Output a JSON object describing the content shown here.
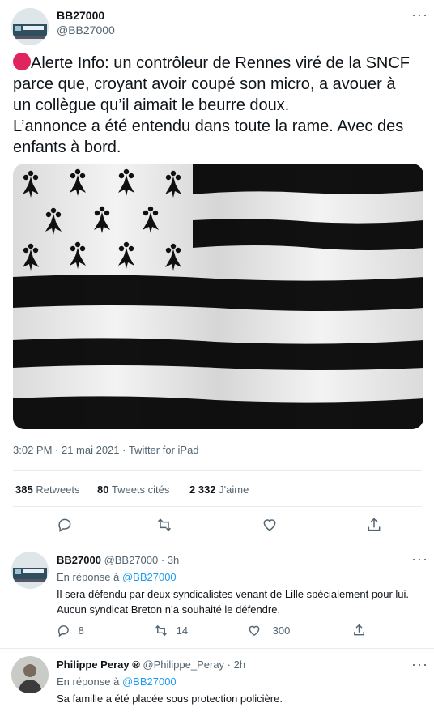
{
  "main_tweet": {
    "display_name": "BB27000",
    "handle": "@BB27000",
    "text_line1": "Alerte Info: un contrôleur de Rennes viré de la SNCF",
    "text_line2": "parce que, croyant avoir coupé son micro, a avouer à",
    "text_line3": "un collègue qu’il aimait le beurre doux.",
    "text_line4": "L’annonce a été entendu dans toute la rame. Avec des",
    "text_line5": "enfants à bord.",
    "meta": "3:02 PM · 21 mai 2021 · Twitter for iPad",
    "retweets_count": "385",
    "retweets_label": "Retweets",
    "quotes_count": "80",
    "quotes_label": "Tweets cités",
    "likes_count": "2 332",
    "likes_label": "J'aime"
  },
  "replies": [
    {
      "display_name": "BB27000",
      "handle_time": "@BB27000 · 3h",
      "in_reply_prefix": "En réponse à",
      "in_reply_handle": "@BB27000",
      "text_line1": "Il sera défendu par deux syndicalistes venant de Lille spécialement pour lui.",
      "text_line2": "Aucun syndicat Breton n’a souhaité le défendre.",
      "reply_count": "8",
      "retweet_count": "14",
      "like_count": "300"
    },
    {
      "display_name": "Philippe Peray ®",
      "handle_time": "@Philippe_Peray · 2h",
      "in_reply_prefix": "En réponse à",
      "in_reply_handle": "@BB27000",
      "text_line1": "Sa famille a été placée sous protection policière."
    }
  ],
  "colors": {
    "accent": "#1d9bf0",
    "muted": "#536471",
    "alert_dot": "#e0245e",
    "flag_black": "#111111"
  },
  "icons": [
    "more-icon",
    "red-circle-icon",
    "reply-icon",
    "retweet-icon",
    "like-icon",
    "share-icon",
    "ermine-icon"
  ]
}
